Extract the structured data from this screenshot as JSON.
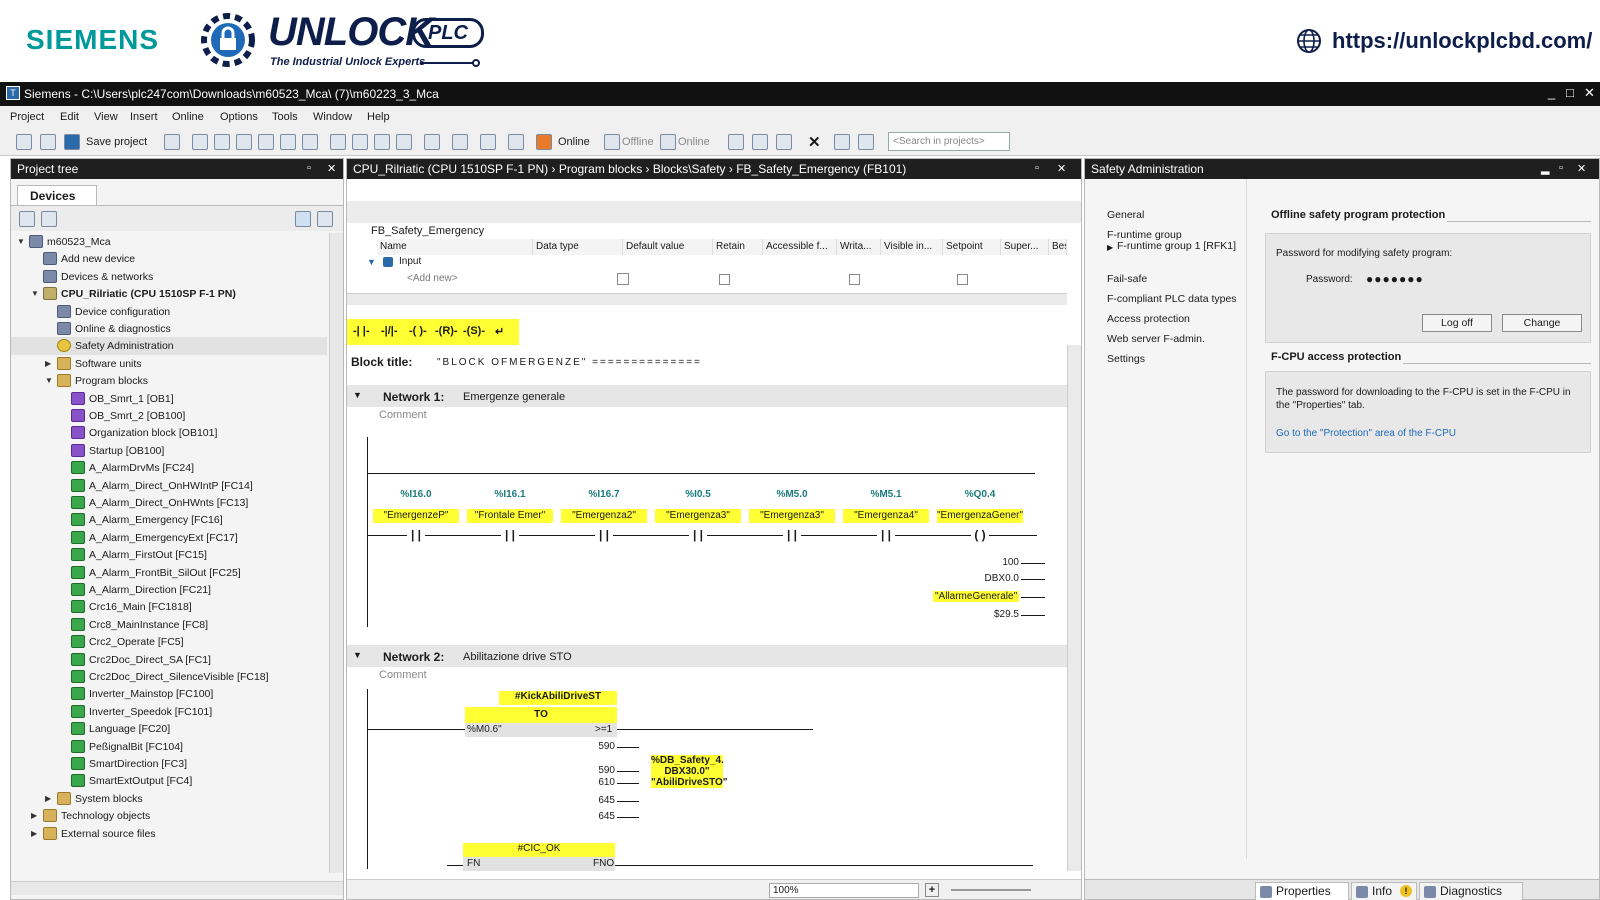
{
  "banner": {
    "brand": "SIEMENS",
    "logo_main": "UNLOCK",
    "logo_badge": "PLC",
    "logo_tagline": "The Industrial Unlock Experts",
    "url": "https://unlockplcbd.com/"
  },
  "window": {
    "title": "Siemens -  C:\\Users\\plc247com\\Downloads\\m60523_Mca\\ (7)\\m60223_3_Mca",
    "controls": [
      "_",
      "□",
      "✕"
    ]
  },
  "menu": [
    "Project",
    "Edit",
    "View",
    "Insert",
    "Online",
    "Options",
    "Tools",
    "Window",
    "Help"
  ],
  "toolbar": {
    "save_label": "Save project",
    "go_online": "Online",
    "go_offline": "Offline",
    "online": "Online",
    "search_placeholder": "<Search in projects>"
  },
  "project_tree": {
    "title": "Project tree",
    "tab": "Devices",
    "items": [
      {
        "label": "m60523_Mca",
        "level": 0,
        "icon": "project-icon",
        "expanded": true
      },
      {
        "label": "Add new device",
        "level": 1,
        "icon": "add-device-icon"
      },
      {
        "label": "Devices & networks",
        "level": 1,
        "icon": "network-icon"
      },
      {
        "label": "CPU_Rilriatic (CPU 1510SP F-1 PN)",
        "level": 1,
        "icon": "cpu-icon",
        "expanded": true,
        "bold": true
      },
      {
        "label": "Device configuration",
        "level": 2,
        "icon": "device-config-icon"
      },
      {
        "label": "Online & diagnostics",
        "level": 2,
        "icon": "diagnostics-icon"
      },
      {
        "label": "Safety Administration",
        "level": 2,
        "icon": "safety-icon",
        "selected": true
      },
      {
        "label": "Software units",
        "level": 2,
        "icon": "folder-icon",
        "collapsed": true
      },
      {
        "label": "Program blocks",
        "level": 2,
        "icon": "folder-icon",
        "expanded": true
      },
      {
        "label": "OB_Smrt_1 [OB1]",
        "level": 3,
        "icon": "ob-icon"
      },
      {
        "label": "OB_Smrt_2 [OB100]",
        "level": 3,
        "icon": "ob-icon"
      },
      {
        "label": "Organization block [OB101]",
        "level": 3,
        "icon": "ob-icon"
      },
      {
        "label": "Startup [OB100]",
        "level": 3,
        "icon": "ob-icon"
      },
      {
        "label": "A_AlarmDrvMs [FC24]",
        "level": 3,
        "icon": "fc-icon"
      },
      {
        "label": "A_Alarm_Direct_OnHWIntP [FC14]",
        "level": 3,
        "icon": "fc-icon"
      },
      {
        "label": "A_Alarm_Direct_OnHWnts [FC13]",
        "level": 3,
        "icon": "fc-icon"
      },
      {
        "label": "A_Alarm_Emergency [FC16]",
        "level": 3,
        "icon": "fc-icon"
      },
      {
        "label": "A_Alarm_EmergencyExt [FC17]",
        "level": 3,
        "icon": "fc-icon"
      },
      {
        "label": "A_Alarm_FirstOut [FC15]",
        "level": 3,
        "icon": "fc-icon"
      },
      {
        "label": "A_Alarm_FrontBit_SilOut [FC25]",
        "level": 3,
        "icon": "fc-icon"
      },
      {
        "label": "A_Alarm_Direction [FC21]",
        "level": 3,
        "icon": "fc-icon"
      },
      {
        "label": "Crc16_Main [FC1818]",
        "level": 3,
        "icon": "fc-icon"
      },
      {
        "label": "Crc8_MainInstance [FC8]",
        "level": 3,
        "icon": "fc-icon"
      },
      {
        "label": "Crc2_Operate [FC5]",
        "level": 3,
        "icon": "fc-icon"
      },
      {
        "label": "Crc2Doc_Direct_SA [FC1]",
        "level": 3,
        "icon": "fc-icon"
      },
      {
        "label": "Crc2Doc_Direct_SilenceVisible [FC18]",
        "level": 3,
        "icon": "fc-icon"
      },
      {
        "label": "Inverter_Mainstop [FC100]",
        "level": 3,
        "icon": "fc-icon"
      },
      {
        "label": "Inverter_Speedok [FC101]",
        "level": 3,
        "icon": "fc-icon"
      },
      {
        "label": "Language [FC20]",
        "level": 3,
        "icon": "fc-icon"
      },
      {
        "label": "PeßignalBit [FC104]",
        "level": 3,
        "icon": "fc-icon"
      },
      {
        "label": "SmartDirection [FC3]",
        "level": 3,
        "icon": "fc-icon"
      },
      {
        "label": "SmartExtOutput [FC4]",
        "level": 3,
        "icon": "fc-icon"
      },
      {
        "label": "System blocks",
        "level": 2,
        "icon": "folder-icon",
        "collapsed": true
      },
      {
        "label": "Technology objects",
        "level": 1,
        "icon": "folder-icon",
        "collapsed": true
      },
      {
        "label": "External source files",
        "level": 1,
        "icon": "folder-icon",
        "collapsed": true
      }
    ]
  },
  "editor": {
    "breadcrumb": "CPU_Rilriatic (CPU 1510SP F-1 PN)  ›  Program blocks  ›  Blocks\\Safety  ›  FB_Safety_Emergency (FB101)",
    "block_name": "FB_Safety_Emergency",
    "interface_columns": [
      "Name",
      "Data type",
      "Default value",
      "Retain",
      "Accessible f...",
      "Writa...",
      "Visible in...",
      "Setpoint",
      "Super...",
      "Bes"
    ],
    "interface_rows": [
      "Input",
      "<Add new>"
    ],
    "lad_elements": [
      "-| |-",
      "-|/|-",
      "-| |-",
      "-( )-",
      "-(R)-",
      "-(S)-",
      "↵"
    ],
    "block_title_label": "Block title:",
    "block_title_value": "\"BLOCK OFMERGENZE\" ==============",
    "network1": {
      "label": "Network 1:",
      "title": "Emergenze generale",
      "comment": "Comment",
      "contacts": [
        {
          "addr": "%I16.0",
          "tag": "\"EmergenzeP\""
        },
        {
          "addr": "%I16.1",
          "tag": "\"Frontale Emer\""
        },
        {
          "addr": "%I16.7",
          "tag": "\"Emergenza2\""
        },
        {
          "addr": "%I0.5",
          "tag": "\"Emergenza3\""
        },
        {
          "addr": "%M5.0",
          "tag": "\"Emergenza3\""
        },
        {
          "addr": "%M5.1",
          "tag": "\"Emergenza4\""
        },
        {
          "addr": "%Q0.4",
          "tag": "\"EmergenzaGener\""
        }
      ],
      "param_values": [
        "100",
        "DBX0.0",
        "\"AllarmeGenerale\"",
        "$29.5"
      ]
    },
    "network2": {
      "label": "Network 2:",
      "title": "Abilitazione drive STO",
      "comment": "Comment",
      "timer_instance": "#KickAbiliDriveST",
      "timer_type": "TO",
      "timer_input": "%M0.6\"",
      "timer_output": ">=1",
      "values": [
        "590",
        "590",
        "610",
        "645",
        "645"
      ],
      "db_tag_line1": "%DB_Safety_4.",
      "db_tag_line2": "DBX30.0\"",
      "db_tag_line3": "\"AbiliDriveSTO\"",
      "second_block": "#CIC_OK",
      "fn": "FN",
      "fno": "FNO"
    },
    "zoom": "100%"
  },
  "safety_admin": {
    "title": "Safety Administration",
    "nav": [
      "General",
      "F-runtime group",
      "F-runtime group 1 [RFK1]",
      "Fail-safe",
      "F-compliant PLC data types",
      "Access protection",
      "Web server F-admin.",
      "Settings"
    ],
    "offline_section": "Offline safety program protection",
    "password_heading": "Password for modifying safety program:",
    "password_label": "Password:",
    "password_value": "●●●●●●●",
    "logoff_button": "Log off",
    "change_button": "Change",
    "fcpu_section": "F-CPU access protection",
    "fcpu_text": "The password for downloading to the F-CPU is set in the F-CPU in the \"Properties\" tab.",
    "fcpu_link": "Go to the \"Protection\" area of the F-CPU"
  },
  "bottom_tabs": {
    "properties": "Properties",
    "info": "Info",
    "diagnostics": "Diagnostics"
  },
  "colors": {
    "siemens_teal": "#009999",
    "highlight_yellow": "#ffff33",
    "panel_header": "#1f1f1f",
    "link_blue": "#1e6ab8"
  }
}
